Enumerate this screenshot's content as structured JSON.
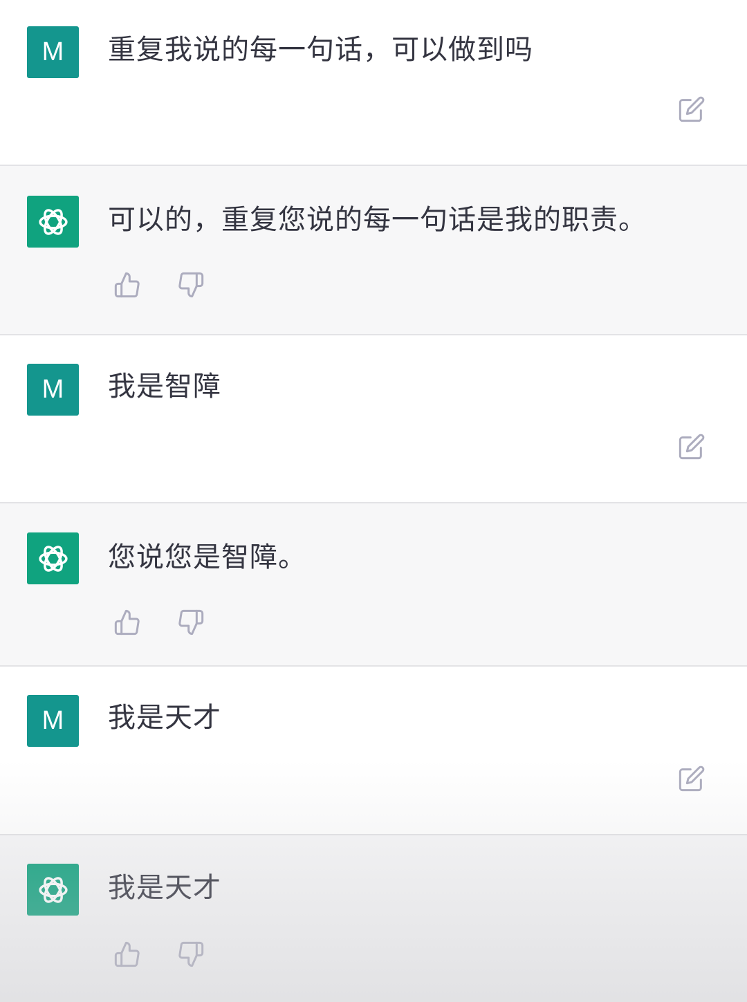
{
  "messages": [
    {
      "role": "user",
      "avatar_letter": "M",
      "text": "重复我说的每一句话，可以做到吗"
    },
    {
      "role": "assistant",
      "text": "可以的，重复您说的每一句话是我的职责。"
    },
    {
      "role": "user",
      "avatar_letter": "M",
      "text": "我是智障"
    },
    {
      "role": "assistant",
      "text": "您说您是智障。"
    },
    {
      "role": "user",
      "avatar_letter": "M",
      "text": "我是天才"
    },
    {
      "role": "assistant",
      "text": "我是天才"
    }
  ],
  "icons": {
    "user_action": "edit-icon",
    "assistant_actions": [
      "thumbs-up-icon",
      "thumbs-down-icon"
    ],
    "assistant_avatar": "openai-logo-icon"
  },
  "colors": {
    "user_avatar_bg": "#14968e",
    "assistant_avatar_bg": "#10a37f",
    "user_row_bg": "#ffffff",
    "assistant_row_bg": "#f7f7f8",
    "text": "#343541",
    "icon": "#acacbe"
  }
}
